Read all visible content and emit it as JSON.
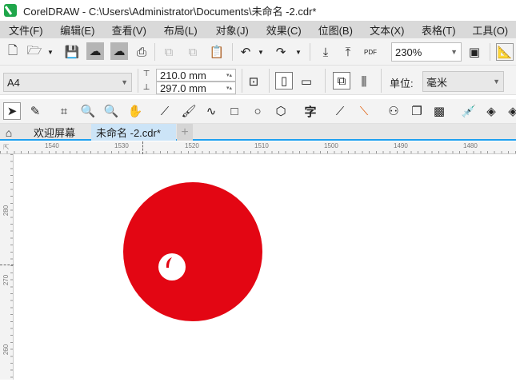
{
  "window": {
    "title": "CorelDRAW - C:\\Users\\Administrator\\Documents\\未命名 -2.cdr*"
  },
  "menu": [
    "文件(F)",
    "编辑(E)",
    "查看(V)",
    "布局(L)",
    "对象(J)",
    "效果(C)",
    "位图(B)",
    "文本(X)",
    "表格(T)",
    "工具(O)"
  ],
  "toolbar": {
    "zoom": "230%",
    "pdf_label": "PDF"
  },
  "property_bar": {
    "page_size": "A4",
    "width": "210.0 mm",
    "height": "297.0 mm",
    "unit_label": "单位:",
    "unit": "毫米"
  },
  "tabs": [
    {
      "label": "欢迎屏幕"
    },
    {
      "label": "未命名 -2.cdr*"
    }
  ],
  "hruler": [
    "1540",
    "1530",
    "1520",
    "1510",
    "1500",
    "1490",
    "1480"
  ],
  "vruler": [
    "280",
    "270",
    "260"
  ],
  "colors": {
    "red": "#e30613",
    "accent": "#1ea0f0"
  }
}
